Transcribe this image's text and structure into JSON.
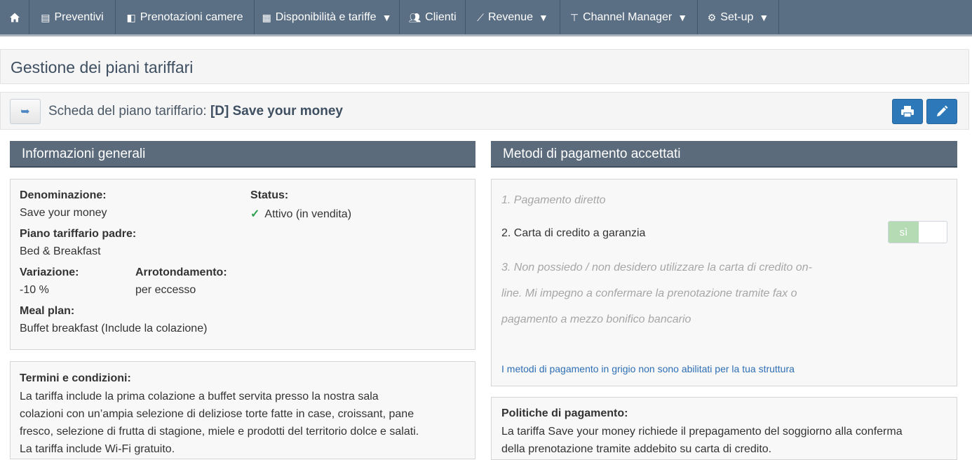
{
  "nav": {
    "items": [
      {
        "label": "Preventivi",
        "icon": "document-icon",
        "caret": ""
      },
      {
        "label": "Prenotazioni camere",
        "icon": "book-icon",
        "caret": ""
      },
      {
        "label": "Disponibilità e tariffe",
        "icon": "calendar-icon",
        "caret": "▼"
      },
      {
        "label": "Clienti",
        "icon": "users-icon",
        "caret": ""
      },
      {
        "label": "Revenue",
        "icon": "trend-icon",
        "caret": "▼"
      },
      {
        "label": "Channel Manager",
        "icon": "signpost-icon",
        "caret": "▼"
      },
      {
        "label": "Set-up",
        "icon": "gear-icon",
        "caret": "▼"
      }
    ]
  },
  "page": {
    "title": "Gestione dei piani tariffari"
  },
  "plan": {
    "prefix": "Scheda del piano tariffario:",
    "name": "[D] Save your money"
  },
  "general": {
    "header": "Informazioni generali",
    "denominazione_label": "Denominazione:",
    "denominazione_value": "Save your money",
    "status_label": "Status:",
    "status_value": "Attivo (in vendita)",
    "padre_label": "Piano tariffario padre:",
    "padre_value": "Bed & Breakfast",
    "variazione_label": "Variazione:",
    "variazione_value": "-10 %",
    "arrotondamento_label": "Arrotondamento:",
    "arrotondamento_value": "per eccesso",
    "meal_label": "Meal plan:",
    "meal_value": "Buffet breakfast (Include la colazione)"
  },
  "terms": {
    "label": "Termini e condizioni:",
    "lines": [
      "La tariffa include la prima colazione a buffet servita presso la nostra sala",
      "colazioni con un’ampia selezione di deliziose torte fatte in case, croissant, pane",
      "fresco, selezione di frutta di stagione, miele e prodotti del territorio dolce e salati.",
      "La tariffa include Wi-Fi gratuito."
    ]
  },
  "payment": {
    "header": "Metodi di pagamento accettati",
    "method1": "1. Pagamento diretto",
    "method2": "2. Carta di credito a garanzia",
    "method2_toggle": "sì",
    "method3_lines": [
      "3. Non possiedo / non desidero utilizzare la carta di credito on-",
      "line. Mi impegno a confermare la prenotazione tramite fax o",
      "pagamento a mezzo bonifico bancario"
    ],
    "note": "I metodi di pagamento in grigio non sono abilitati per la tua struttura"
  },
  "policy": {
    "label": "Politiche di pagamento:",
    "lines": [
      "La tariffa Save your money richiede il prepagamento del soggiorno alla conferma",
      "della prenotazione tramite addebito su carta di credito."
    ]
  },
  "colors": {
    "navbar": "#5b6f84",
    "section_header": "#5b6b7b",
    "primary_button": "#2d78b8",
    "status_green": "#2ea04f",
    "link_blue": "#2d6eb5"
  }
}
